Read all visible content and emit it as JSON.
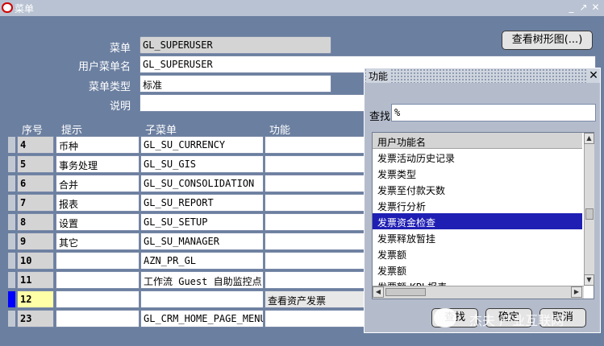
{
  "window": {
    "title": "菜单"
  },
  "form": {
    "menu_label": "菜单",
    "menu_value": "GL_SUPERUSER",
    "user_menu_name_label": "用户菜单名",
    "user_menu_name_value": "GL_SUPERUSER",
    "menu_type_label": "菜单类型",
    "menu_type_value": "标准",
    "description_label": "说明",
    "description_value": "",
    "view_tree_button": "查看树形图(...)"
  },
  "table": {
    "headers": {
      "seq": "序号",
      "prompt": "提示",
      "submenu": "子菜单",
      "function": "功能"
    },
    "rows": [
      {
        "seq": "4",
        "prompt": "币种",
        "submenu": "GL_SU_CURRENCY",
        "function": ""
      },
      {
        "seq": "5",
        "prompt": "事务处理",
        "submenu": "GL_SU_GIS",
        "function": ""
      },
      {
        "seq": "6",
        "prompt": "合并",
        "submenu": "GL_SU_CONSOLIDATION",
        "function": ""
      },
      {
        "seq": "7",
        "prompt": "报表",
        "submenu": "GL_SU_REPORT",
        "function": ""
      },
      {
        "seq": "8",
        "prompt": "设置",
        "submenu": "GL_SU_SETUP",
        "function": ""
      },
      {
        "seq": "9",
        "prompt": "其它",
        "submenu": "GL_SU_MANAGER",
        "function": ""
      },
      {
        "seq": "10",
        "prompt": "",
        "submenu": "AZN_PR_GL",
        "function": ""
      },
      {
        "seq": "11",
        "prompt": "",
        "submenu": "工作流 Guest 自助监控点",
        "function": ""
      },
      {
        "seq": "12",
        "prompt": "",
        "submenu": "",
        "function": "查看资产发票"
      },
      {
        "seq": "23",
        "prompt": "",
        "submenu": "GL_CRM_HOME_PAGE_MENU",
        "function": ""
      }
    ],
    "selected_row_index": 8
  },
  "dialog": {
    "title": "功能",
    "find_label": "查找",
    "find_value": "%",
    "list_header": "用户功能名",
    "items": [
      "发票活动历史记录",
      "发票类型",
      "发票至付款天数",
      "发票行分析",
      "发票资金检查",
      "发票释放暂挂",
      "发票额",
      "发票额",
      "发票额 KPI 报表"
    ],
    "selected_index": 4,
    "ok_button": "确定",
    "cancel_button": "取消",
    "find_button": "查找"
  },
  "watermark": {
    "text": "杰夫 产业互联网"
  },
  "colors": {
    "background": "#6b7fa0",
    "selection": "#1f1fb4",
    "current_record": "#ffffa8",
    "current_indicator": "#0000ff"
  }
}
